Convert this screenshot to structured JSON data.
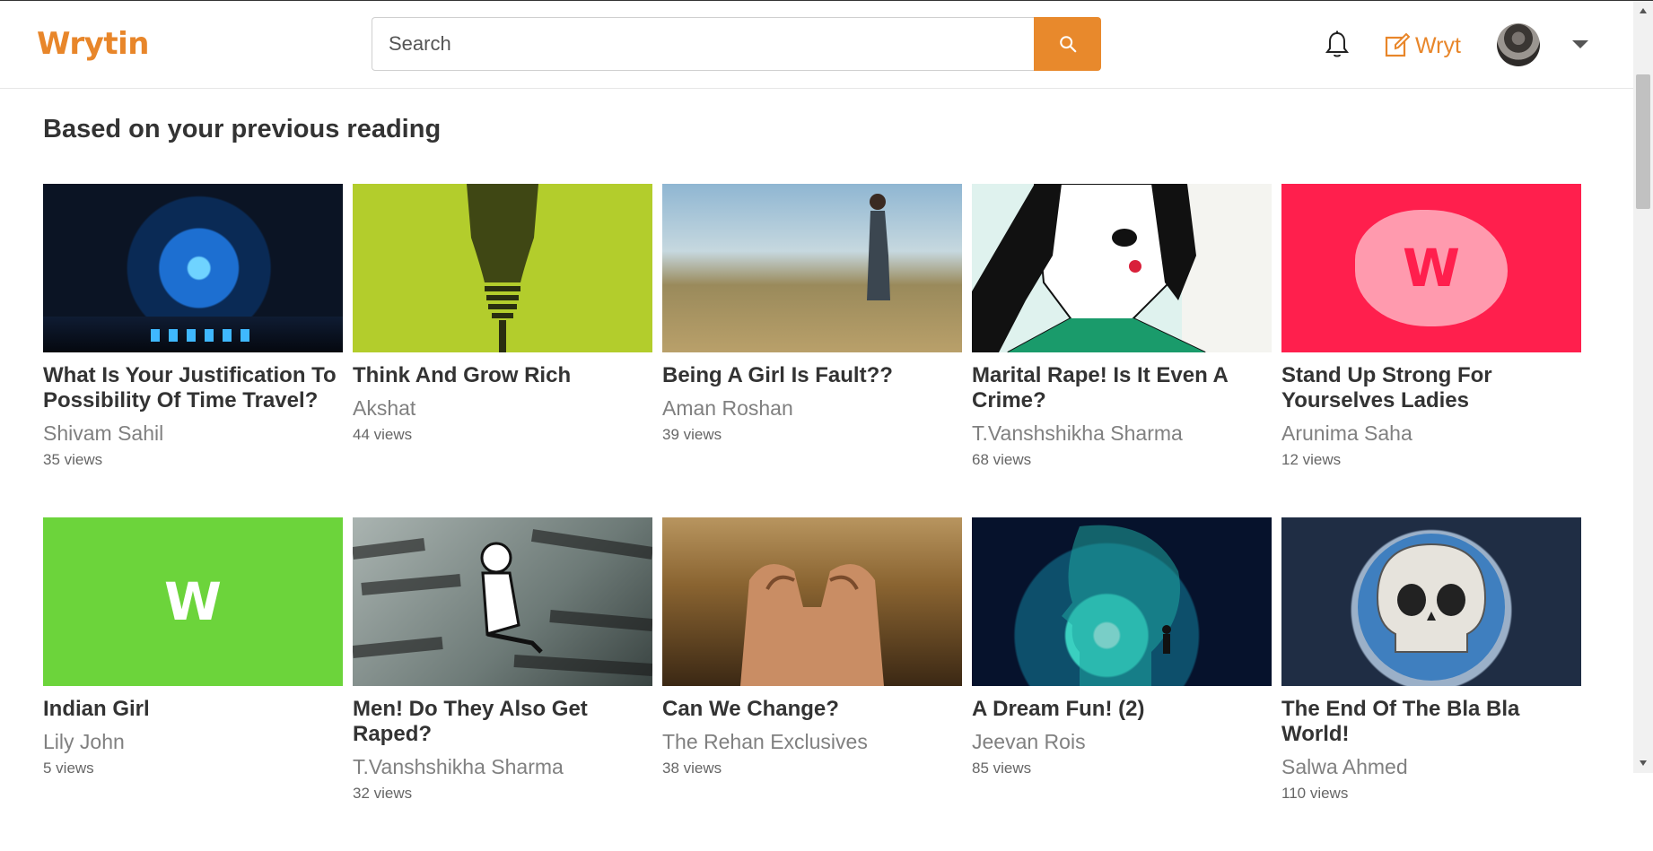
{
  "header": {
    "logo": "Wrytin",
    "search_placeholder": "Search",
    "wryt_label": "Wryt"
  },
  "section": {
    "title": "Based on your previous reading"
  },
  "cards": [
    {
      "title": "What Is Your Justification To Possibility Of Time Travel?",
      "author": "Shivam Sahil",
      "views": "35 views",
      "thumb_icon": "time-travel-thumbnail"
    },
    {
      "title": "Think And Grow Rich",
      "author": "Akshat",
      "views": "44 views",
      "thumb_icon": "lightbulb-thumbnail"
    },
    {
      "title": "Being A Girl Is Fault??",
      "author": "Aman Roshan",
      "views": "39 views",
      "thumb_icon": "girl-in-field-thumbnail"
    },
    {
      "title": "Marital Rape! Is It Even A Crime?",
      "author": "T.Vanshshikha Sharma",
      "views": "68 views",
      "thumb_icon": "woman-illustration-thumbnail"
    },
    {
      "title": "Stand Up Strong For Yourselves Ladies",
      "author": "Arunima Saha",
      "views": "12 views",
      "thumb_icon": "wrytin-w-pink-thumbnail"
    },
    {
      "title": "Indian Girl",
      "author": "Lily John",
      "views": "5 views",
      "thumb_icon": "wrytin-w-green-thumbnail"
    },
    {
      "title": "Men! Do They Also Get Raped?",
      "author": "T.Vanshshikha Sharma",
      "views": "32 views",
      "thumb_icon": "boy-graffiti-thumbnail"
    },
    {
      "title": "Can We Change?",
      "author": "The Rehan Exclusives",
      "views": "38 views",
      "thumb_icon": "clasped-hands-thumbnail"
    },
    {
      "title": "A Dream Fun! (2)",
      "author": "Jeevan Rois",
      "views": "85 views",
      "thumb_icon": "cosmic-head-thumbnail"
    },
    {
      "title": "The End Of The Bla Bla World!",
      "author": "Salwa Ahmed",
      "views": "110 views",
      "thumb_icon": "skull-globe-thumbnail"
    }
  ],
  "thumb_letters": {
    "pink": "W",
    "green": "W"
  },
  "colors": {
    "brand": "#e8862a",
    "pink_thumb": "#ff1f4d",
    "green_thumb": "#6cd43b"
  }
}
